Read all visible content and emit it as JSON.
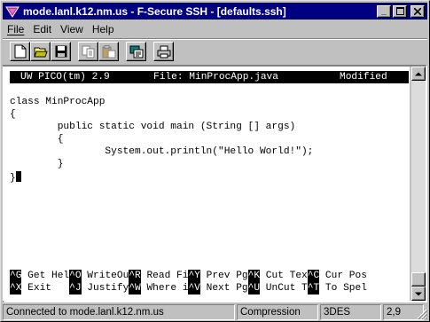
{
  "window": {
    "title": "mode.lanl.k12.nm.us - F-Secure SSH - [defaults.ssh]",
    "minimize_glyph": "_",
    "maximize_glyph": "□",
    "close_glyph": "✕"
  },
  "menu": {
    "file": "File",
    "edit": "Edit",
    "view": "View",
    "help": "Help"
  },
  "toolbar": {
    "icons": [
      "new-document-icon",
      "open-folder-icon",
      "save-disk-icon",
      "copy-icon",
      "paste-icon",
      "properties-icon",
      "print-icon"
    ]
  },
  "editor": {
    "app": "UW PICO(tm) 2.9",
    "file_label": "File: MinProcApp.java",
    "state": "Modified",
    "lines": [
      "class MinProcApp",
      "{",
      "        public static void main (String [] args)",
      "        {",
      "                System.out.println(\"Hello World!\");",
      "        }",
      "}"
    ],
    "shortcuts_row1": [
      {
        "key": "^G",
        "label": " Get Hel"
      },
      {
        "key": "^O",
        "label": " WriteOu"
      },
      {
        "key": "^R",
        "label": " Read Fi"
      },
      {
        "key": "^Y",
        "label": " Prev Pg"
      },
      {
        "key": "^K",
        "label": " Cut Tex"
      },
      {
        "key": "^C",
        "label": " Cur Pos"
      }
    ],
    "shortcuts_row2": [
      {
        "key": "^X",
        "label": " Exit   "
      },
      {
        "key": "^J",
        "label": " Justify"
      },
      {
        "key": "^W",
        "label": " Where i"
      },
      {
        "key": "^V",
        "label": " Next Pg"
      },
      {
        "key": "^U",
        "label": " UnCut T"
      },
      {
        "key": "^T",
        "label": " To Spel"
      }
    ]
  },
  "status": {
    "connection": "Connected to mode.lanl.k12.nm.us",
    "compression": "Compression",
    "cipher": "3DES",
    "position": "2,9"
  }
}
